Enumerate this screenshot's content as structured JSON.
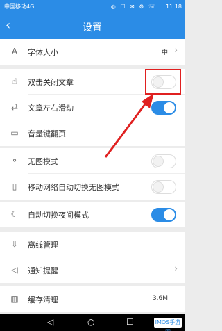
{
  "status": {
    "carrier": "中国移动4G",
    "icons": "◎ ☐ ✉ ⚙ ☏",
    "time": "11:18"
  },
  "header": {
    "back_icon": "‹",
    "title": "设置"
  },
  "settings": [
    {
      "label": "字体大小",
      "value": "中",
      "type": "link",
      "icon": "font-size-icon"
    },
    {
      "label": "双击关闭文章",
      "type": "toggle",
      "on": false,
      "icon": "double-tap-icon"
    },
    {
      "label": "文章左右滑动",
      "type": "toggle",
      "on": true,
      "icon": "swipe-icon"
    },
    {
      "label": "音量键翻页",
      "type": "toggle",
      "on": false,
      "icon": "volume-page-icon"
    },
    {
      "label": "无图模式",
      "type": "toggle",
      "on": false,
      "icon": "no-image-icon"
    },
    {
      "label": "移动网络自动切换无图模式",
      "type": "toggle",
      "on": false,
      "icon": "mobile-network-icon"
    },
    {
      "label": "自动切换夜间模式",
      "type": "toggle",
      "on": true,
      "icon": "night-mode-icon"
    },
    {
      "label": "离线管理",
      "type": "link",
      "icon": "offline-icon"
    },
    {
      "label": "通知提醒",
      "type": "link",
      "icon": "notification-icon"
    },
    {
      "label": "缓存清理",
      "value": "3.6M",
      "type": "link",
      "icon": "cache-icon"
    }
  ],
  "accent_color": "#2b8ce6",
  "annotation_color": "#e02020",
  "nav": {
    "back": "◁",
    "home": "○",
    "recent": "☐"
  },
  "watermark": "IMOS手游网"
}
